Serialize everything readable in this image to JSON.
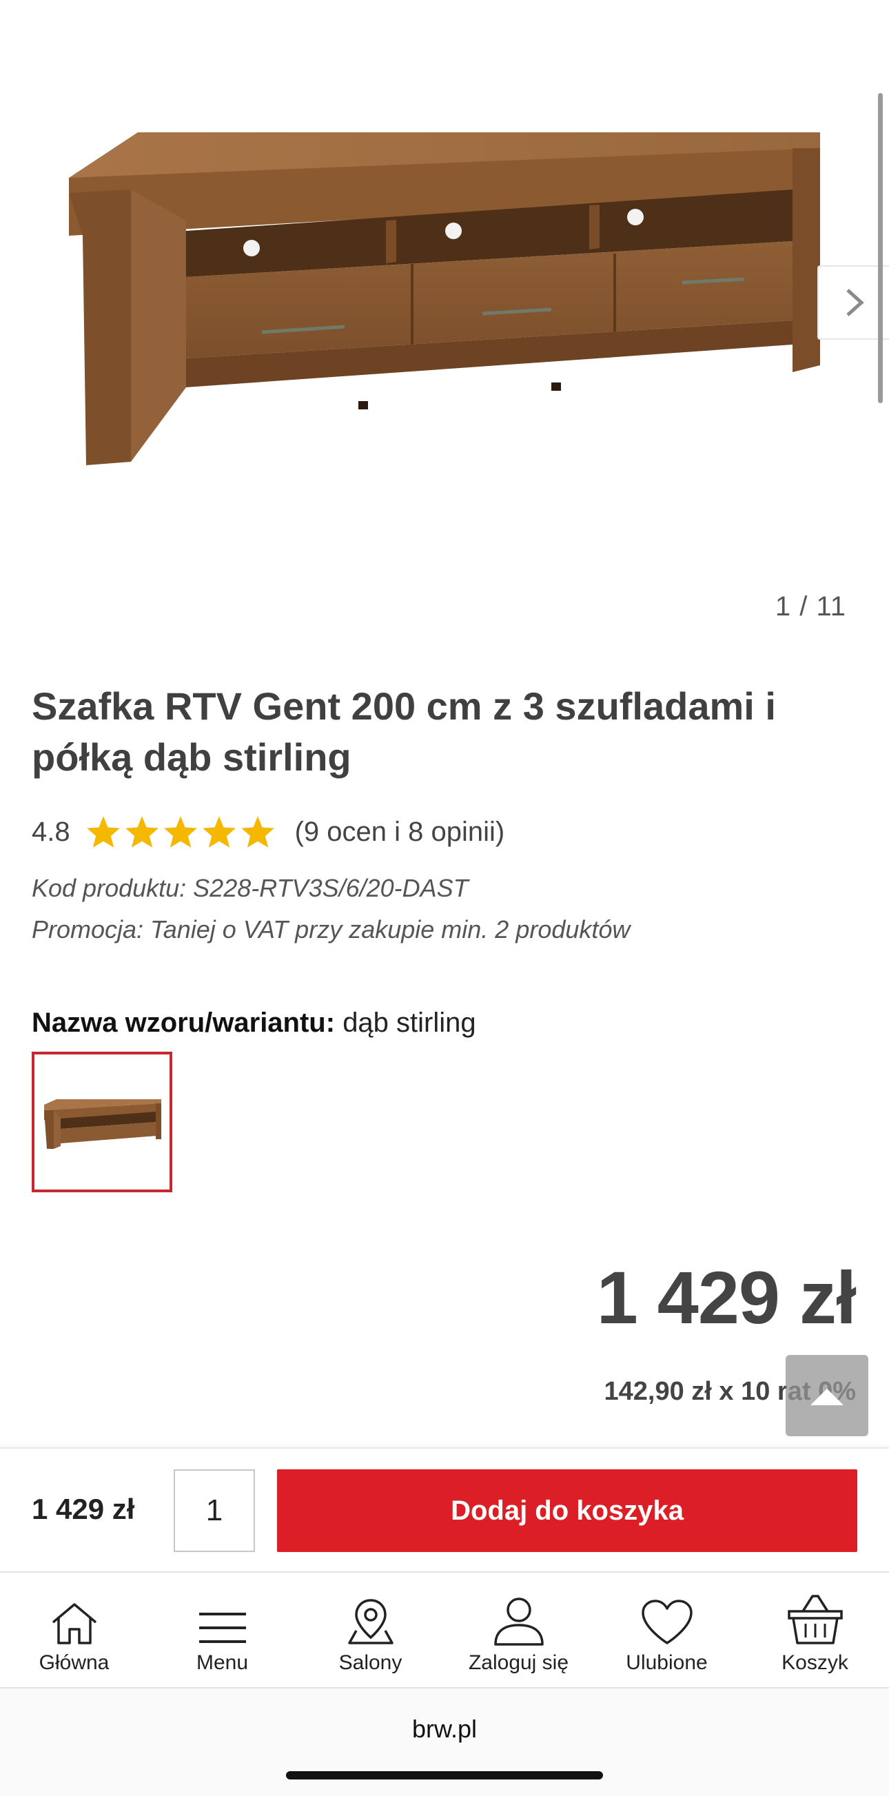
{
  "gallery": {
    "counter": "1 / 11",
    "image_alt": "Szafka RTV Gent - dąb stirling",
    "next_icon": "chevron-right-icon"
  },
  "product": {
    "title": "Szafka RTV Gent 200 cm z 3 szufladami i półką dąb stirling",
    "rating": "4.8",
    "stars_filled": 5,
    "stars_total": 5,
    "reviews": "(9 ocen i 8 opinii)",
    "code": "Kod produktu: S228-RTV3S/6/20-DAST",
    "promo": "Promocja: Taniej o VAT przy zakupie min. 2 produktów",
    "variant_label": "Nazwa wzoru/wariantu:",
    "variant_value": "dąb stirling",
    "price": "1 429 zł",
    "installments": "142,90 zł x 10 rat 0%"
  },
  "buy_bar": {
    "price": "1 429 zł",
    "quantity": "1",
    "add_to_cart": "Dodaj do koszyka"
  },
  "nav": {
    "items": [
      {
        "label": "Główna",
        "icon": "home-icon"
      },
      {
        "label": "Menu",
        "icon": "menu-icon"
      },
      {
        "label": "Salony",
        "icon": "map-pin-icon"
      },
      {
        "label": "Zaloguj się",
        "icon": "user-icon"
      },
      {
        "label": "Ulubione",
        "icon": "heart-icon"
      },
      {
        "label": "Koszyk",
        "icon": "basket-icon"
      }
    ]
  },
  "browser": {
    "url": "brw.pl"
  },
  "colors": {
    "accent": "#dc1f26",
    "star": "#f5b800",
    "wood": "#8a5a32"
  }
}
